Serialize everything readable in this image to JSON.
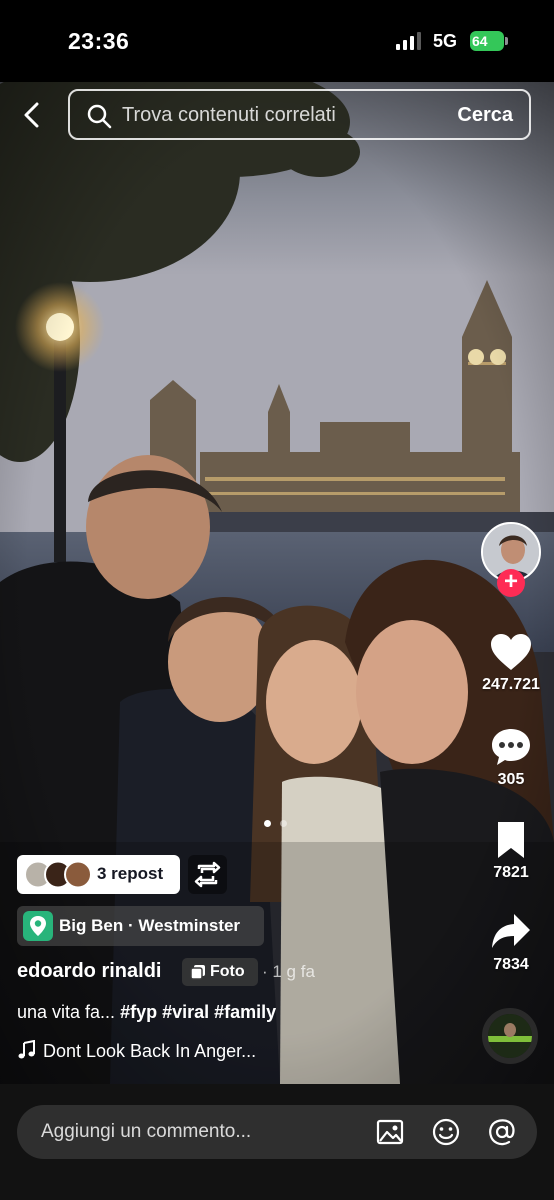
{
  "status_bar": {
    "time": "23:36",
    "network": "5G",
    "battery": "64"
  },
  "search": {
    "placeholder": "Trova contenuti correlati",
    "action_label": "Cerca"
  },
  "rail": {
    "likes": "247.721",
    "comments": "305",
    "saves": "7821",
    "shares": "7834",
    "follow_symbol": "+"
  },
  "post": {
    "repost_label": "3 repost",
    "location": "Big Ben · Westminster",
    "username": "edoardo rinaldi",
    "type_label": "Foto",
    "time_ago": "· 1 g fa",
    "caption_text": "una vita fa... ",
    "caption_tags": "#fyp #viral #family",
    "music": "Dont Look Back In Anger..."
  },
  "carousel": {
    "total": 2,
    "current": 1
  },
  "comment_bar": {
    "placeholder": "Aggiungi un commento..."
  },
  "colors": {
    "accent": "#fe2c55",
    "battery": "#34c759",
    "location": "#28b47b"
  },
  "icons": [
    "back-icon",
    "search-icon",
    "heart-icon",
    "comment-icon",
    "bookmark-icon",
    "share-icon",
    "repost-icon",
    "location-pin-icon",
    "photo-icon",
    "music-note-icon",
    "image-icon",
    "emoji-icon",
    "mention-icon"
  ]
}
